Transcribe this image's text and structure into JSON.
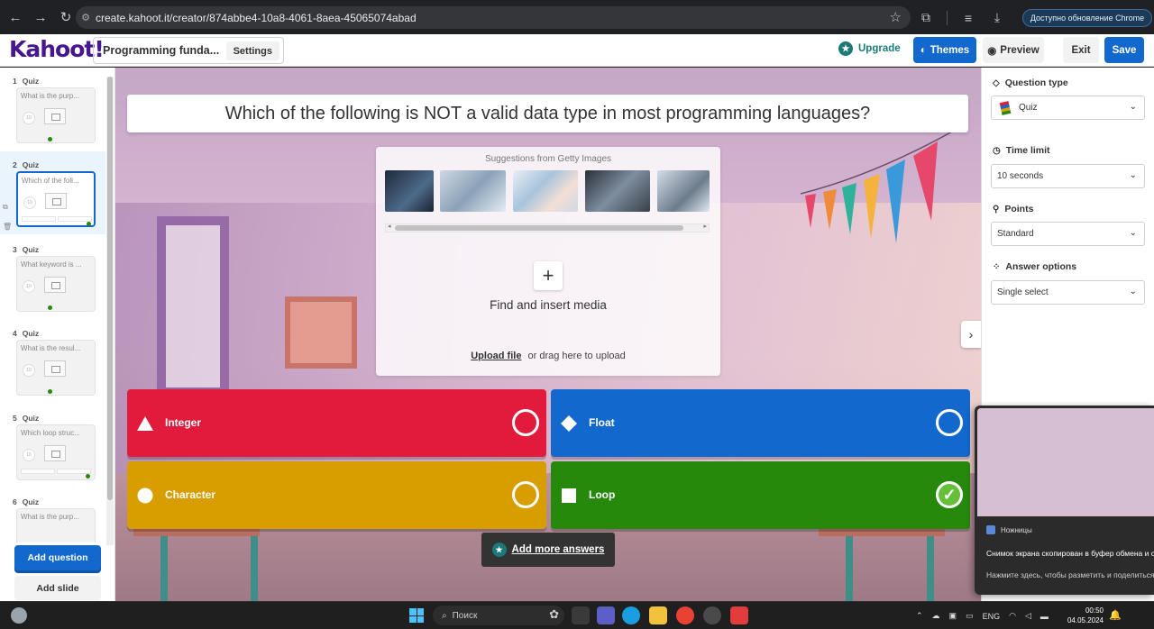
{
  "browser": {
    "url": "create.kahoot.it/creator/874abbe4-10a8-4061-8aea-45065074abad",
    "update_button": "Доступно обновление Chrome"
  },
  "header": {
    "logo": "Kahoot!",
    "kahoot_title": "Programming funda...",
    "settings_label": "Settings",
    "upgrade_label": "Upgrade",
    "themes_label": "Themes",
    "preview_label": "Preview",
    "exit_label": "Exit",
    "save_label": "Save"
  },
  "sidebar": {
    "slides": [
      {
        "number": "1",
        "type": "Quiz",
        "preview": "What is the purp..."
      },
      {
        "number": "2",
        "type": "Quiz",
        "preview": "Which of the foll..."
      },
      {
        "number": "3",
        "type": "Quiz",
        "preview": "What keyword is ..."
      },
      {
        "number": "4",
        "type": "Quiz",
        "preview": "What is the resul..."
      },
      {
        "number": "5",
        "type": "Quiz",
        "preview": "Which loop struc..."
      },
      {
        "number": "6",
        "type": "Quiz",
        "preview": "What is the purp..."
      }
    ],
    "add_question_label": "Add question",
    "add_slide_label": "Add slide"
  },
  "question": {
    "text": "Which of the following is NOT a valid data type in most programming languages?"
  },
  "media": {
    "suggestions_label": "Suggestions from Getty Images",
    "find_label": "Find and insert media",
    "upload_link": "Upload file",
    "upload_hint": "or drag here to upload"
  },
  "answers": [
    {
      "text": "Integer",
      "color": "#e21b3c",
      "shape": "triangle",
      "correct": false
    },
    {
      "text": "Float",
      "color": "#1368ce",
      "shape": "diamond",
      "correct": false
    },
    {
      "text": "Character",
      "color": "#d89e00",
      "shape": "circle",
      "correct": false
    },
    {
      "text": "Loop",
      "color": "#26890c",
      "shape": "square",
      "correct": true
    }
  ],
  "add_more_answers_label": "Add more answers",
  "settings": {
    "question_type_label": "Question type",
    "question_type_value": "Quiz",
    "time_limit_label": "Time limit",
    "time_limit_value": "10 seconds",
    "points_label": "Points",
    "points_value": "Standard",
    "answer_options_label": "Answer options",
    "answer_options_value": "Single select"
  },
  "toast": {
    "app_name": "Ножницы",
    "title": "Снимок экрана скопирован в буфер обмена и сохранен",
    "body": "Нажмите здесь, чтобы разметить и поделиться"
  },
  "taskbar": {
    "search_placeholder": "Поиск",
    "language": "ENG",
    "time": "00:50",
    "date": "04.05.2024"
  },
  "colors": {
    "kahoot_purple": "#46178f",
    "primary_blue": "#1368ce",
    "teal": "#1a7a77"
  }
}
